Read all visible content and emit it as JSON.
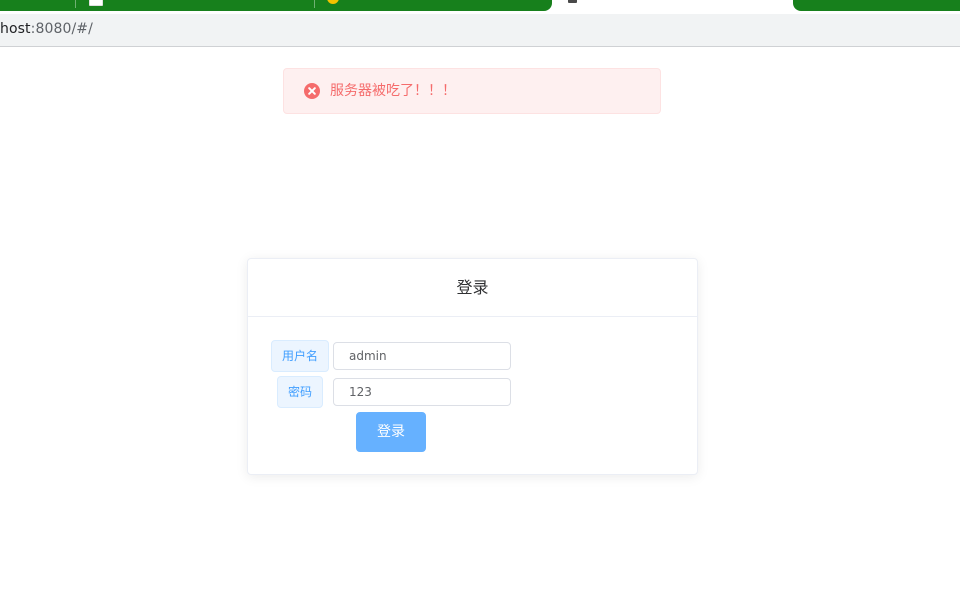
{
  "browser": {
    "url_host": "host",
    "url_rest": ":8080/#/"
  },
  "message": {
    "type": "error",
    "icon": "circle-close-icon",
    "text": "服务器被吃了！！！",
    "color": "#f56c6c"
  },
  "login_card": {
    "title": "登录",
    "username": {
      "label": "用户名",
      "value": "admin"
    },
    "password": {
      "label": "密码",
      "value": "123"
    },
    "submit_label": "登录",
    "accent_color": "#409eff"
  }
}
